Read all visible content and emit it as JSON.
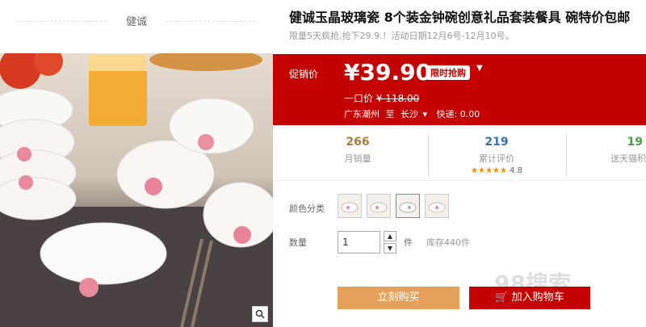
{
  "brand": {
    "name": "健诚"
  },
  "product": {
    "title": "健诚玉晶玻璃瓷 8个装金钟碗创意礼品套装餐具 碗特价包邮",
    "subtitle": "限量5天疯抢,抢下29.9.！活动日期12月6号-12月10号。"
  },
  "price": {
    "label": "促销价",
    "value": "¥39.90",
    "badge": "限时抢购",
    "original_label": "一口价",
    "original_value": "¥ 118.00",
    "origin": "广东潮州",
    "to": "至",
    "destination": "长沙",
    "shipping": "快递: 0.00"
  },
  "stats": {
    "monthly_sales": {
      "value": "266",
      "label": "月销量"
    },
    "reviews": {
      "value": "219",
      "label": "累计评价",
      "stars": "★★★★★",
      "rating": "4.8"
    },
    "points": {
      "value": "19",
      "label": "送天猫积"
    }
  },
  "options": {
    "color_label": "颜色分类",
    "quantity_label": "数量",
    "quantity_value": "1",
    "unit": "件",
    "stock": "库存440件"
  },
  "buttons": {
    "buy_now": "立刻购买",
    "add_to_cart": "加入购物车"
  },
  "watermark": "98搜索",
  "colors": {
    "accent_red": "#c40000",
    "buy_orange": "#e5a05a",
    "stat_blue": "#3b6fb5",
    "stat_green": "#4aa043",
    "star": "#ff8a00"
  }
}
